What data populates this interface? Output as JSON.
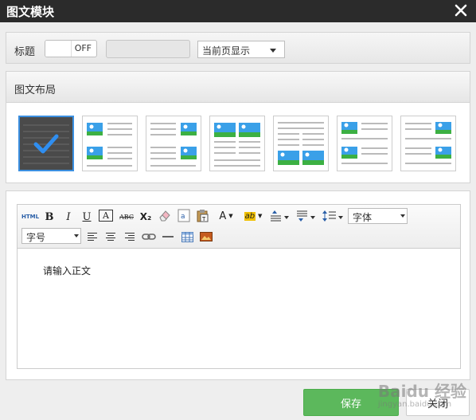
{
  "dialog": {
    "title": "图文模块"
  },
  "title_row": {
    "label": "标题",
    "toggle_state": "OFF",
    "title_value": "",
    "display_select": "当前页显示"
  },
  "layout_section": {
    "header": "图文布局",
    "options": [
      {
        "name": "none",
        "selected": true
      },
      {
        "name": "image-left-text-right",
        "selected": false
      },
      {
        "name": "text-left-image-right",
        "selected": false
      },
      {
        "name": "images-top-text-bottom",
        "selected": false
      },
      {
        "name": "text-top-images-bottom",
        "selected": false
      },
      {
        "name": "image-text-alternating-left",
        "selected": false
      },
      {
        "name": "text-image-alternating-right",
        "selected": false
      }
    ]
  },
  "editor": {
    "font_family_select": "字体",
    "font_size_select": "字号",
    "placeholder": "请输入正文",
    "toolbar_row1": [
      "html",
      "bold",
      "italic",
      "underline",
      "font-border",
      "strikethrough",
      "subscript",
      "eraser",
      "autotypeset",
      "paste-plain",
      "forecolor",
      "backcolor",
      "rowspacing",
      "paragraph",
      "lineheight"
    ],
    "toolbar_row2": [
      "justify-left",
      "justify-center",
      "justify-right",
      "link",
      "horizontal-rule",
      "table",
      "image"
    ],
    "labels": {
      "html": "HTML",
      "bold": "B",
      "italic": "I",
      "underline": "U",
      "font_border": "A",
      "strike": "ABC",
      "subscript": "X₂",
      "forecolor": "A",
      "backcolor": "ab"
    }
  },
  "buttons": {
    "save": "保存",
    "close": "关闭"
  },
  "watermark": {
    "brand": "Baidu 经验",
    "url": "jingyan.baidu.com"
  }
}
